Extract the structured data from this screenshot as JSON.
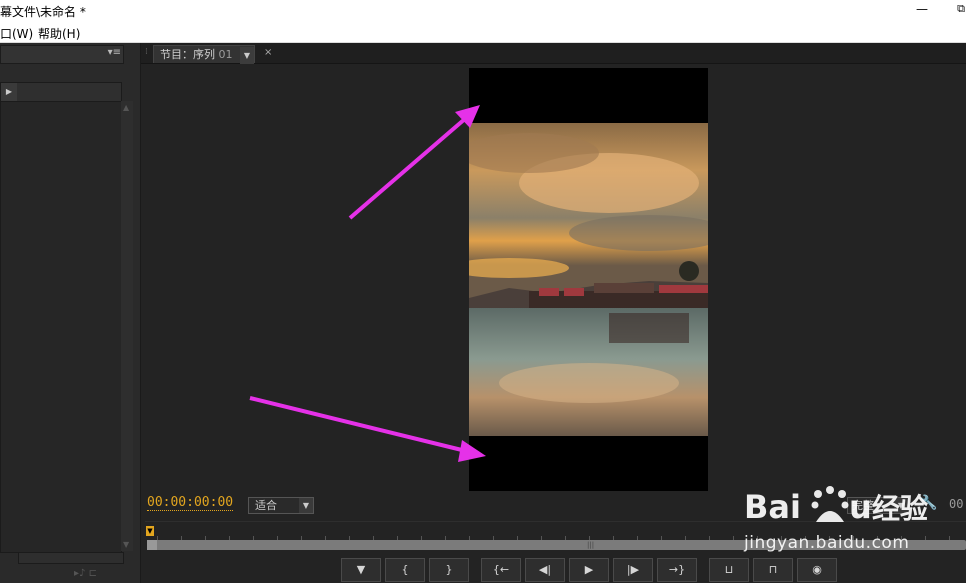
{
  "window": {
    "title": "幕文件\\未命名 *",
    "min_glyph": "—",
    "restore_glyph": "⧉"
  },
  "menubar": {
    "items": [
      "口(W)",
      "帮助(H)"
    ]
  },
  "left_panel": {
    "menu_icon": "▾≡",
    "expand_icon": "▶",
    "scroll_up": "▲",
    "scroll_down": "▼",
    "footer_icons": "▸♪  ⊏"
  },
  "monitor": {
    "tab_label": "节目：序列",
    "tab_sequence": "01",
    "tab_dropdown": "▼",
    "tab_close": "×",
    "timecode": "00:00:00:00",
    "fit_value": "适合",
    "resolution_value": "完整",
    "right_timecode": "00",
    "caret": "▼",
    "playhead_glyph": "▼",
    "scroll_mid": "|||"
  },
  "transport": {
    "buttons": [
      {
        "name": "add-marker",
        "glyph": "▼"
      },
      {
        "name": "mark-in",
        "glyph": "{"
      },
      {
        "name": "mark-out",
        "glyph": "}"
      },
      {
        "name": "go-to-in",
        "glyph": "{←"
      },
      {
        "name": "step-back",
        "glyph": "◀|"
      },
      {
        "name": "play",
        "glyph": "▶"
      },
      {
        "name": "step-forward",
        "glyph": "|▶"
      },
      {
        "name": "go-to-out",
        "glyph": "→}"
      },
      {
        "name": "lift",
        "glyph": "⊔"
      },
      {
        "name": "extract",
        "glyph": "⊓"
      },
      {
        "name": "export-frame",
        "glyph": "◉"
      }
    ]
  },
  "watermark": {
    "logo_text": "Bai du 经验",
    "url": "jingyan.baidu.com"
  },
  "colors": {
    "timecode": "#e3a61f",
    "annotation_arrow": "#e531e8",
    "panel_bg": "#232323"
  }
}
